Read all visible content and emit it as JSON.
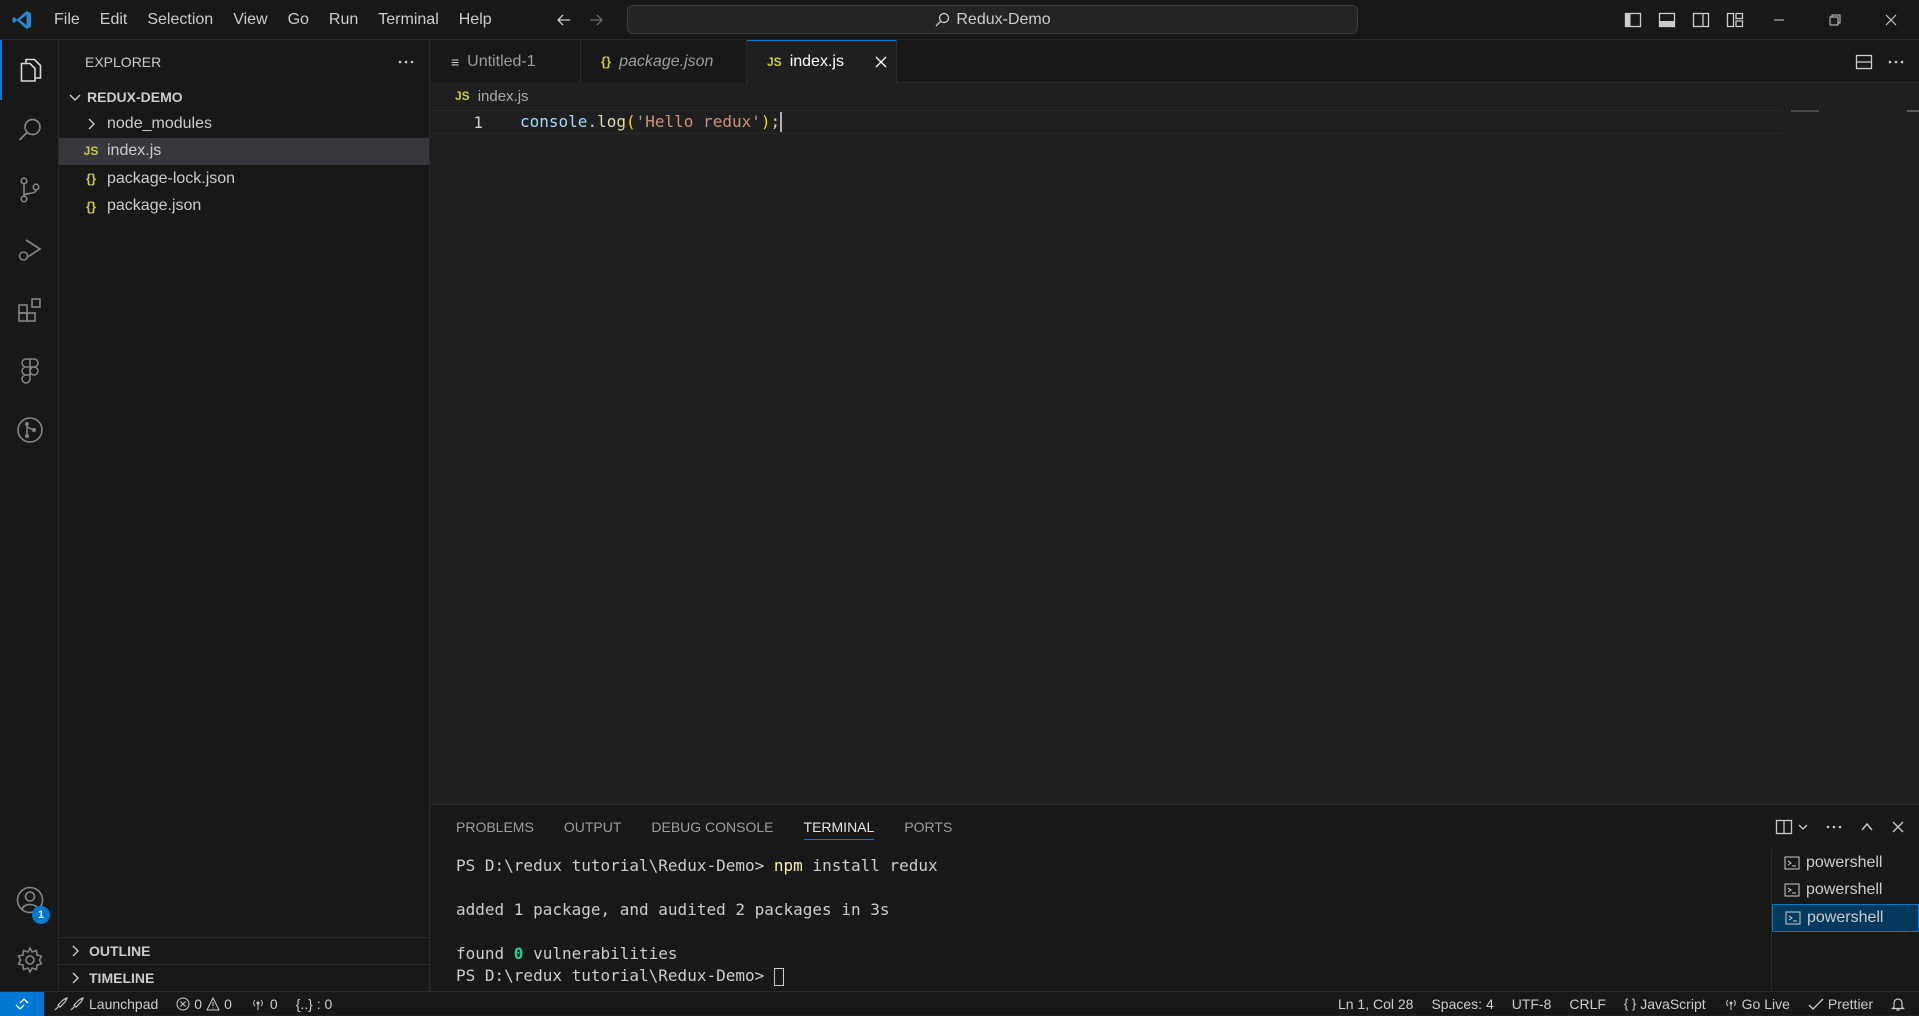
{
  "titlebar": {
    "menu": [
      "File",
      "Edit",
      "Selection",
      "View",
      "Go",
      "Run",
      "Terminal",
      "Help"
    ],
    "search_text": "Redux-Demo"
  },
  "activity": {
    "accounts_badge": "1"
  },
  "explorer": {
    "header": "EXPLORER",
    "workspace": "REDUX-DEMO",
    "items": [
      {
        "label": "node_modules",
        "icon": "chevron-right-icon"
      },
      {
        "label": "index.js",
        "icon": "JS"
      },
      {
        "label": "package-lock.json",
        "icon": "{}"
      },
      {
        "label": "package.json",
        "icon": "{}"
      }
    ],
    "outline": "OUTLINE",
    "timeline": "TIMELINE"
  },
  "editor": {
    "tabs": [
      {
        "label": "Untitled-1",
        "icon": "≡"
      },
      {
        "label": "package.json",
        "icon": "{}"
      },
      {
        "label": "index.js",
        "icon": "JS"
      }
    ],
    "breadcrumb_icon": "JS",
    "breadcrumb": "index.js",
    "line_number": "1",
    "code": {
      "obj": "console",
      "dot": ".",
      "fn": "log",
      "open": "(",
      "str": "'Hello redux'",
      "close": ")",
      "semi": ";"
    }
  },
  "panel": {
    "tabs": [
      "PROBLEMS",
      "OUTPUT",
      "DEBUG CONSOLE",
      "TERMINAL",
      "PORTS"
    ],
    "terminal": {
      "prompt": "PS D:\\redux tutorial\\Redux-Demo> ",
      "cmd": "npm",
      "args": " install redux",
      "result": "added 1 package, and audited 2 packages in 3s",
      "found_prefix": "found ",
      "found_num": "0",
      "found_suffix": " vulnerabilities"
    },
    "terminals": [
      "powershell",
      "powershell",
      "powershell"
    ]
  },
  "statusbar": {
    "launchpad": "Launchpad",
    "errors": "0",
    "warnings": "0",
    "ports": "0",
    "json": "{..} : 0",
    "position": "Ln 1, Col 28",
    "spaces": "Spaces: 4",
    "encoding": "UTF-8",
    "eol": "CRLF",
    "language": "JavaScript",
    "golive": "Go Live",
    "prettier": "Prettier"
  },
  "colors": {
    "accent": "#0078d4",
    "background": "#1f1f1f",
    "chrome": "#181818"
  }
}
